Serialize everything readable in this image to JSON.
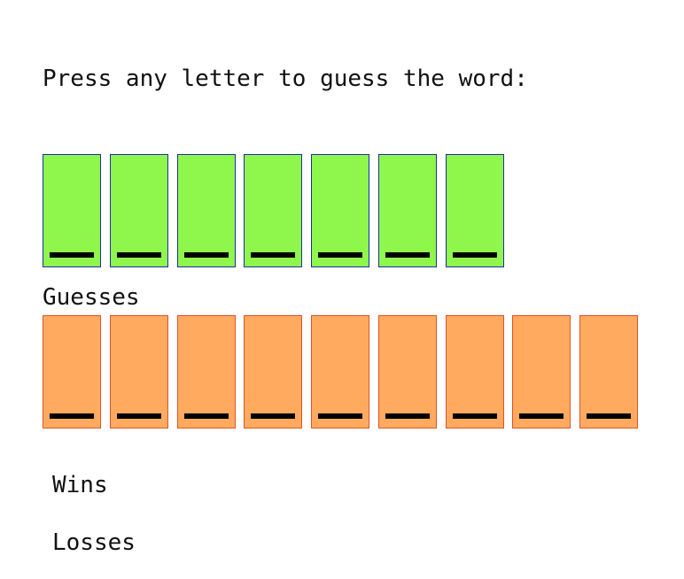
{
  "prompt": "Press any letter to guess the word:",
  "word": {
    "tiles": [
      "",
      "",
      "",
      "",
      "",
      "",
      ""
    ],
    "tile_color": "#8ff64b",
    "border_color": "#1a2fa8"
  },
  "guesses": {
    "label": "Guesses",
    "tiles": [
      "",
      "",
      "",
      "",
      "",
      "",
      "",
      "",
      ""
    ],
    "tile_color": "#ffaa5f",
    "border_color": "#e0522a"
  },
  "stats": {
    "wins_label": "Wins",
    "losses_label": "Losses"
  }
}
